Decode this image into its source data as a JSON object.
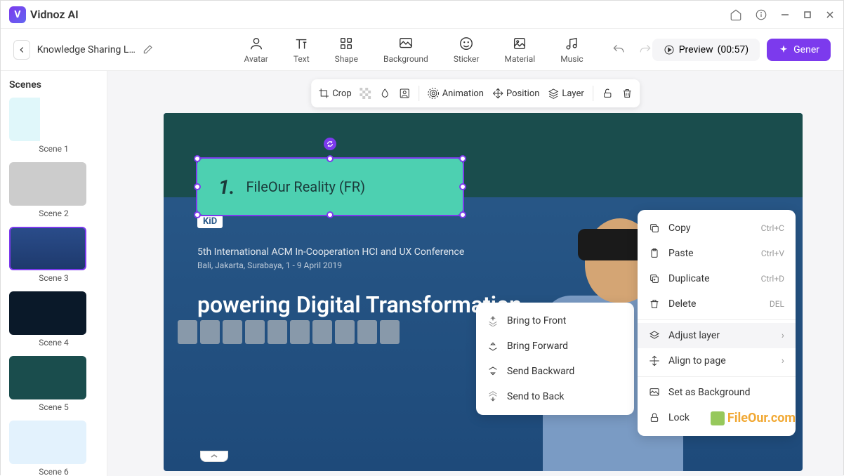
{
  "app": {
    "name": "Vidnoz AI"
  },
  "project": {
    "name": "Knowledge Sharing Lectu..."
  },
  "tools": {
    "avatar": "Avatar",
    "text": "Text",
    "shape": "Shape",
    "background": "Background",
    "sticker": "Sticker",
    "material": "Material",
    "music": "Music"
  },
  "preview": {
    "label": "Preview",
    "time": "(00:57)"
  },
  "generate": {
    "label": "Gener"
  },
  "scenes": {
    "title": "Scenes",
    "items": [
      {
        "label": "Scene 1"
      },
      {
        "label": "Scene 2"
      },
      {
        "label": "Scene 3"
      },
      {
        "label": "Scene 4"
      },
      {
        "label": "Scene 5"
      },
      {
        "label": "Scene 6"
      }
    ]
  },
  "canvasToolbar": {
    "crop": "Crop",
    "animation": "Animation",
    "position": "Position",
    "layer": "Layer"
  },
  "selectedElement": {
    "number": "1.",
    "text": "FileOur Reality (FR)"
  },
  "backgroundContent": {
    "badge": "KiD",
    "line1": "5th International ACM In-Cooperation HCI and UX Conference",
    "line2": "Bali, Jakarta, Surabaya, 1 - 9 April 2019",
    "headline": "powering Digital Transformation"
  },
  "layerMenu": {
    "bringFront": "Bring to Front",
    "bringForward": "Bring Forward",
    "sendBackward": "Send Backward",
    "sendBack": "Send to Back"
  },
  "contextMenu": {
    "copy": {
      "label": "Copy",
      "shortcut": "Ctrl+C"
    },
    "paste": {
      "label": "Paste",
      "shortcut": "Ctrl+V"
    },
    "duplicate": {
      "label": "Duplicate",
      "shortcut": "Ctrl+D"
    },
    "delete": {
      "label": "Delete",
      "shortcut": "DEL"
    },
    "adjustLayer": "Adjust layer",
    "alignPage": "Align to page",
    "setBackground": "Set as Background",
    "lock": "Lock"
  },
  "watermark": "FileOur.com"
}
